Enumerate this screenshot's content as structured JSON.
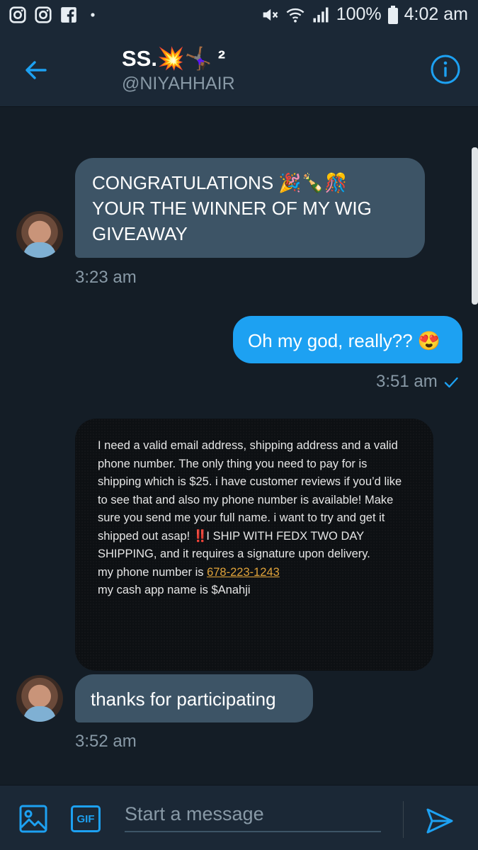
{
  "status_bar": {
    "left_icons": [
      "instagram-icon",
      "instagram-icon",
      "facebook-icon",
      "notification-dot"
    ],
    "battery_pct": "100%",
    "time": "4:02 am"
  },
  "header": {
    "display_name": "SS.💥🤸🏾‍♀️ ²",
    "handle": "@NIYAHHAIR",
    "back_icon": "arrow-left-icon",
    "info_icon": "info-icon"
  },
  "messages": [
    {
      "direction": "incoming",
      "text": "CONGRATULATIONS 🎉🍾🎊\nYOUR THE WINNER OF MY WIG GIVEAWAY",
      "time": "3:23 am"
    },
    {
      "direction": "outgoing",
      "text": "Oh my god, really?? 😍",
      "time": "3:51 am",
      "status_icon": "check-icon"
    },
    {
      "direction": "incoming",
      "type": "image",
      "image_text": {
        "part1": "I need a valid email address, shipping address and a valid phone number. The only thing you need to pay for is shipping which is $25. i have customer reviews if you’d like to see that and also my phone number is available! Make sure you send me your full name. i want to try and get it shipped out asap!  ",
        "bang": "‼️",
        "part2": "I SHIP WITH FEDX TWO DAY SHIPPING, and it requires a signature upon delivery.\nmy phone number is ",
        "phone": "678-223-1243",
        "part3": "\nmy cash app name  is $Anahji"
      }
    },
    {
      "direction": "incoming",
      "text": "thanks for participating",
      "time": "3:52 am"
    }
  ],
  "composer": {
    "placeholder": "Start a message",
    "gif_label": "GIF"
  },
  "colors": {
    "background": "#141d26",
    "bar": "#1b2836",
    "incoming_bubble": "#3d5466",
    "outgoing_bubble": "#1da1f2",
    "accent": "#1da1f2",
    "muted_text": "#8899a6"
  }
}
